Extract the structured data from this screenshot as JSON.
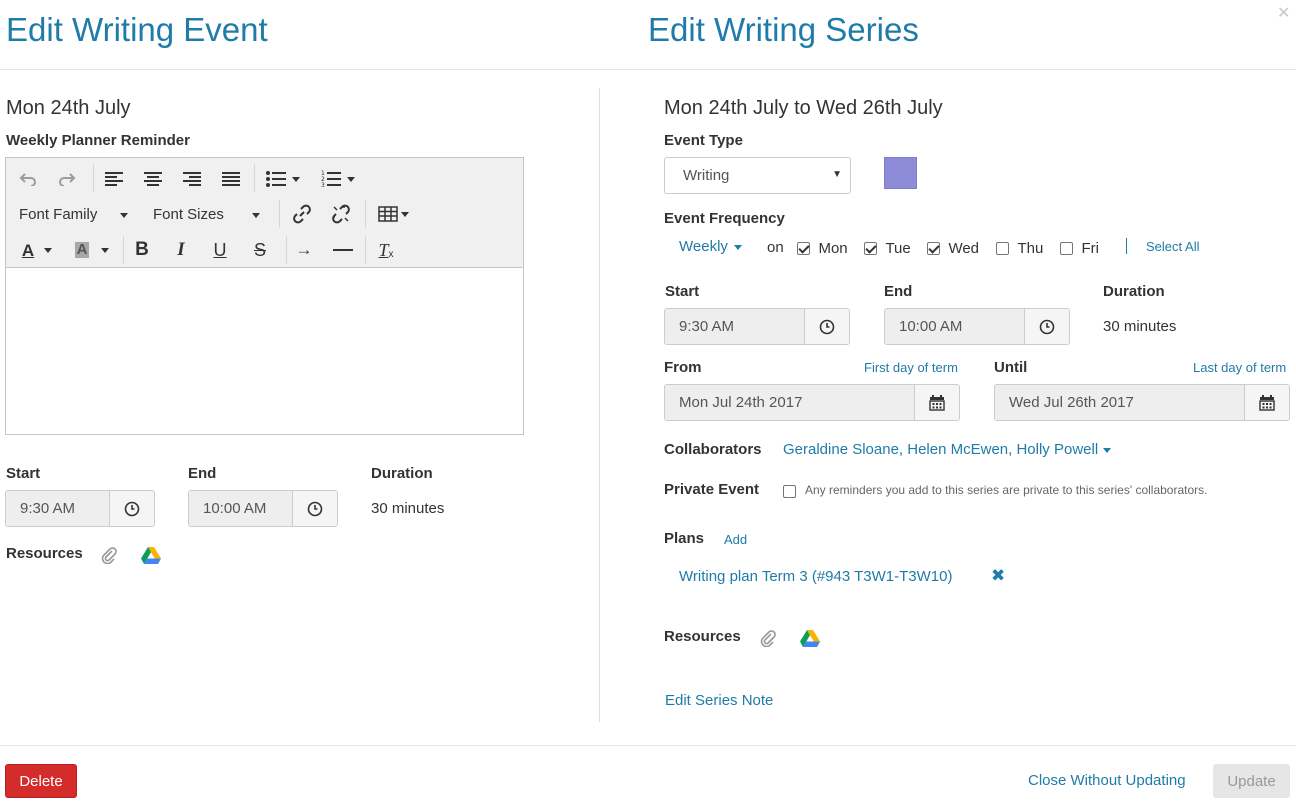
{
  "left": {
    "title": "Edit Writing Event",
    "date": "Mon 24th July",
    "editor_label": "Weekly Planner Reminder",
    "toolbar": {
      "font_family": "Font Family",
      "font_sizes": "Font Sizes"
    },
    "start_label": "Start",
    "start_value": "9:30 AM",
    "end_label": "End",
    "end_value": "10:00 AM",
    "duration_label": "Duration",
    "duration_value": "30 minutes",
    "resources_label": "Resources"
  },
  "right": {
    "title": "Edit Writing Series",
    "date_range": "Mon 24th July to Wed 26th July",
    "event_type_label": "Event Type",
    "event_type_value": "Writing",
    "event_color": "#8e8cd8",
    "frequency_label": "Event Frequency",
    "frequency_value": "Weekly",
    "on_label": "on",
    "days": [
      {
        "label": "Mon",
        "checked": true
      },
      {
        "label": "Tue",
        "checked": true
      },
      {
        "label": "Wed",
        "checked": true
      },
      {
        "label": "Thu",
        "checked": false
      },
      {
        "label": "Fri",
        "checked": false
      }
    ],
    "select_all": "Select All",
    "start_label": "Start",
    "start_value": "9:30 AM",
    "end_label": "End",
    "end_value": "10:00 AM",
    "duration_label": "Duration",
    "duration_value": "30 minutes",
    "from_label": "From",
    "from_link": "First day of term",
    "from_value": "Mon Jul 24th 2017",
    "until_label": "Until",
    "until_link": "Last day of term",
    "until_value": "Wed Jul 26th 2017",
    "collaborators_label": "Collaborators",
    "collaborators_value": "Geraldine Sloane, Helen McEwen, Holly Powell",
    "private_label": "Private Event",
    "private_checked": false,
    "private_note": "Any reminders you add to this series are private to this series' collaborators.",
    "plans_label": "Plans",
    "plans_add": "Add",
    "plan_item": "Writing plan Term 3 (#943 T3W1-T3W10)",
    "resources_label": "Resources",
    "edit_series_note": "Edit Series Note"
  },
  "footer": {
    "delete_label": "Delete",
    "close_without_updating": "Close Without Updating",
    "update_label": "Update"
  },
  "colors": {
    "accent": "#1f7ba8",
    "danger": "#d42b2b"
  }
}
